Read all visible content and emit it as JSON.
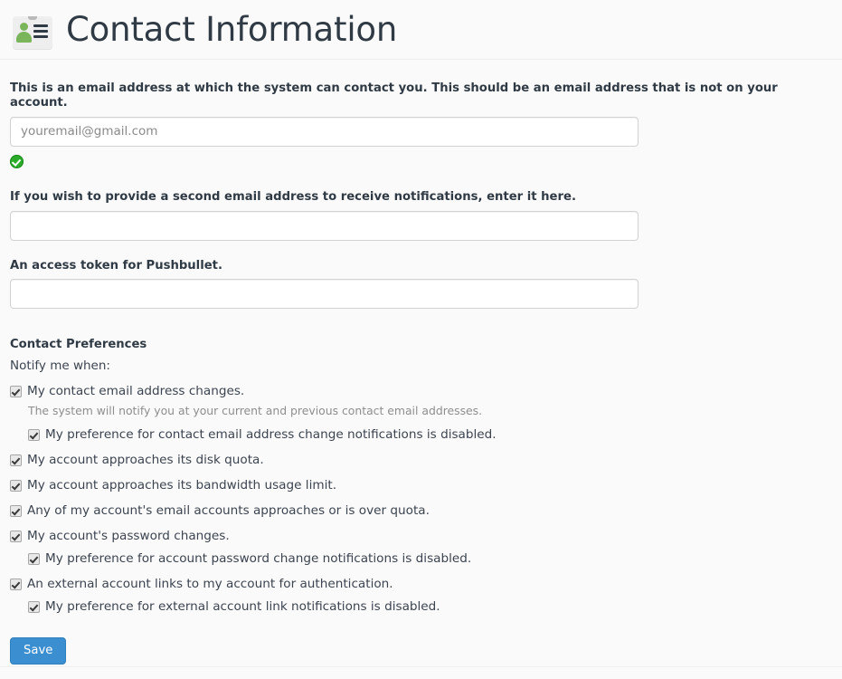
{
  "header": {
    "title": "Contact Information",
    "icon": "contact-card-icon"
  },
  "form": {
    "contact_email": {
      "label": "This is an email address at which the system can contact you. This should be an email address that is not on your account.",
      "value": "youremail@gmail.com",
      "placeholder": "youremail@gmail.com",
      "validation_icon": "green-check-circle-icon"
    },
    "second_email": {
      "label": "If you wish to provide a second email address to receive notifications, enter it here.",
      "value": "",
      "placeholder": ""
    },
    "pushbullet_token": {
      "label": "An access token for Pushbullet.",
      "value": "",
      "placeholder": ""
    }
  },
  "preferences": {
    "title": "Contact Preferences",
    "intro": "Notify me when:",
    "items": [
      {
        "label": "My contact email address changes.",
        "checked": true,
        "help": "The system will notify you at your current and previous contact email addresses.",
        "children": [
          {
            "label": "My preference for contact email address change notifications is disabled.",
            "checked": true
          }
        ]
      },
      {
        "label": "My account approaches its disk quota.",
        "checked": true,
        "help": "",
        "children": []
      },
      {
        "label": "My account approaches its bandwidth usage limit.",
        "checked": true,
        "help": "",
        "children": []
      },
      {
        "label": "Any of my account's email accounts approaches or is over quota.",
        "checked": true,
        "help": "",
        "children": []
      },
      {
        "label": "My account's password changes.",
        "checked": true,
        "help": "",
        "children": [
          {
            "label": "My preference for account password change notifications is disabled.",
            "checked": true
          }
        ]
      },
      {
        "label": "An external account links to my account for authentication.",
        "checked": true,
        "help": "",
        "children": [
          {
            "label": "My preference for external account link notifications is disabled.",
            "checked": true
          }
        ]
      }
    ]
  },
  "actions": {
    "save_label": "Save"
  },
  "colors": {
    "page_background": "#fafafa",
    "primary_button": "#3b8ed0",
    "valid_green": "#2aab2a",
    "title_text": "#2f3a45",
    "help_text": "#8e8e8e"
  }
}
